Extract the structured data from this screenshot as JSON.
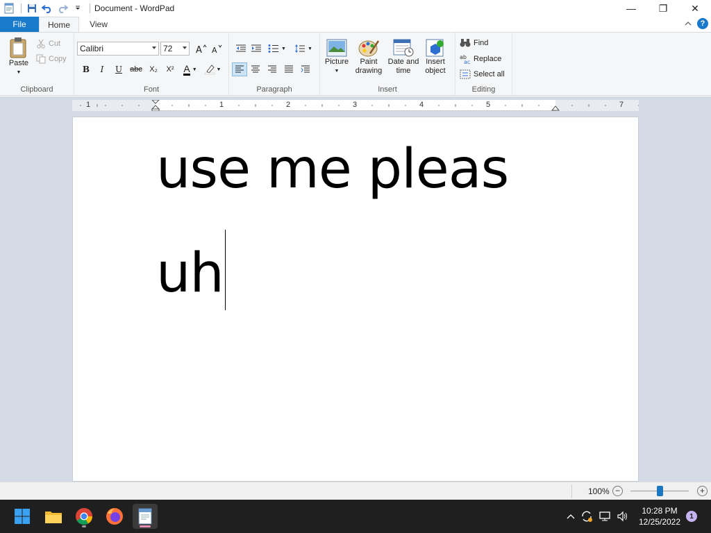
{
  "window": {
    "title": "Document - WordPad",
    "minimize": "—",
    "restore": "❐",
    "close": "✕"
  },
  "tabs": [
    {
      "label": "File"
    },
    {
      "label": "Home"
    },
    {
      "label": "View"
    }
  ],
  "ribbon": {
    "clipboard": {
      "label": "Clipboard",
      "paste": "Paste",
      "cut": "Cut",
      "copy": "Copy"
    },
    "font": {
      "label": "Font",
      "family": "Calibri",
      "size": "72",
      "bold": "B",
      "italic": "I",
      "underline": "U",
      "strike": "abc",
      "subscript": "X₂",
      "superscript": "X²",
      "color_letter": "A"
    },
    "paragraph": {
      "label": "Paragraph"
    },
    "insert": {
      "label": "Insert",
      "picture": "Picture",
      "paint_line1": "Paint",
      "paint_line2": "drawing",
      "datetime_line1": "Date and",
      "datetime_line2": "time",
      "object_line1": "Insert",
      "object_line2": "object"
    },
    "editing": {
      "label": "Editing",
      "find": "Find",
      "replace": "Replace",
      "select_all": "Select all"
    }
  },
  "ruler": {
    "numbers": [
      "1",
      "1",
      "2",
      "3",
      "4",
      "5",
      "7"
    ]
  },
  "document": {
    "line1": "use me pleas",
    "line2": "uh"
  },
  "status": {
    "zoom": "100%",
    "zoom_value_percent": 100
  },
  "taskbar": {
    "time": "10:28 PM",
    "date": "12/25/2022",
    "notifications": "1"
  },
  "colors": {
    "accent": "#1979ca",
    "ribbon_bg": "#f5f6f7",
    "canvas_bg": "#d4dbe6",
    "taskbar_bg": "#1f1f1f"
  }
}
